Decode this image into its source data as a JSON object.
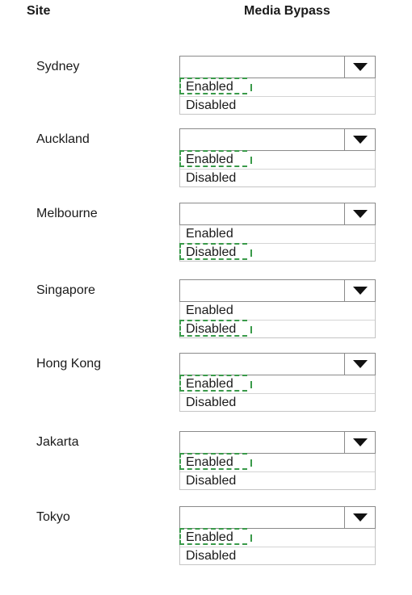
{
  "header": {
    "site_label": "Site",
    "media_bypass_label": "Media Bypass"
  },
  "colors": {
    "selection_marker": "#3a9a4a"
  },
  "dropdown": {
    "arrow_icon": "triangle-down-icon",
    "options": [
      "Enabled",
      "Disabled"
    ]
  },
  "sites": [
    {
      "name": "Sydney",
      "selected": "Enabled"
    },
    {
      "name": "Auckland",
      "selected": "Enabled"
    },
    {
      "name": "Melbourne",
      "selected": "Disabled"
    },
    {
      "name": "Singapore",
      "selected": "Disabled"
    },
    {
      "name": "Hong Kong",
      "selected": "Enabled"
    },
    {
      "name": "Jakarta",
      "selected": "Enabled"
    },
    {
      "name": "Tokyo",
      "selected": "Enabled"
    }
  ]
}
